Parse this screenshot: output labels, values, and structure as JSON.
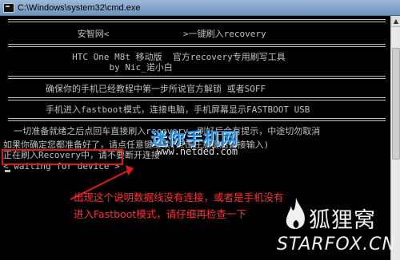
{
  "window": {
    "title": "C:\\Windows\\system32\\cmd.exe"
  },
  "console": {
    "line1": "              安智网<              >一键刷入recovery",
    "line2": "             HTC One M8t 移动版  官方recovery专用刷写工具",
    "line3": "                    by Nic_诺小白",
    "line4": "        确保你的手机已经教程中第一步所说官方解锁 或者SOFF",
    "line5": "        手机进入fastboot模式，连接电脑，手机屏幕显示FASTBOOT USB",
    "line6": "  一切准备就绪之后点回车直接刷入recovery，刷好后会有提示，中途切勿取消",
    "line7": "如果你确定您都准备好了，请点任意键继续(点击任意键后直接输入)",
    "line8": "正在刷入Recovery中，请不要断开连接",
    "line9": "< waiting for device >"
  },
  "annotation": {
    "line1": "出现这个说明数据线没有连接，或者是手机没有",
    "line2": "进入Fastboot模式，请仔细再检查一下"
  },
  "watermarks": {
    "site_name": "迷你手机网",
    "site_url": "www.netded.com",
    "fox_name": "狐狸窝",
    "fox_url": "STARFOX.CN"
  },
  "colors": {
    "console_text": "#c0c0c0",
    "highlight": "#e01818",
    "annotation": "#ff3030",
    "watermark_blue": "#1e8ee8"
  }
}
